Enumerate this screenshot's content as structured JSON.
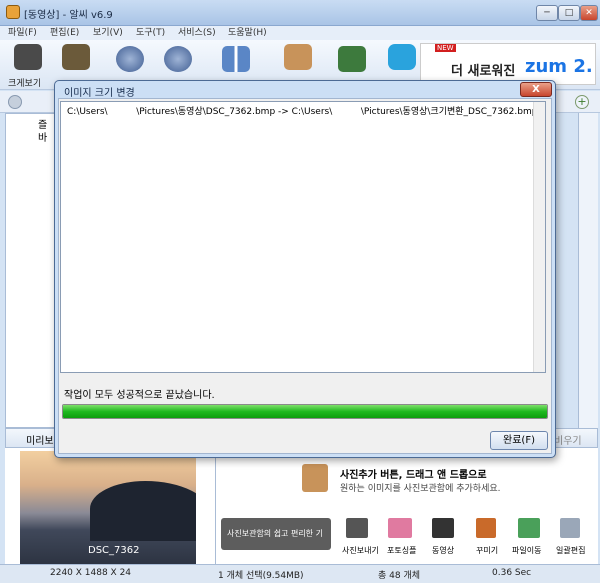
{
  "window": {
    "title": "[동영상] - 알씨 v6.9"
  },
  "menu": [
    "파일(F)",
    "편집(E)",
    "보기(V)",
    "도구(T)",
    "서비스(S)",
    "도움말(H)"
  ],
  "toolbar": {
    "first_label": "크게보기"
  },
  "ad": {
    "new_badge": "NEW",
    "text": "더 새로워진",
    "brand": "zum 2."
  },
  "tree": [
    "즐",
    "바"
  ],
  "preview": {
    "header": "미리보",
    "caption": "DSC_7362",
    "hidden_button": "비우기"
  },
  "storage": {
    "hint_title": "사진추가 버튼, 드래그 앤 드롭으로",
    "hint_sub": "원하는 이미지를 사진보관함에 추가하세요.",
    "banner": "사진보관함의 쉽고 편리한 기",
    "tools": [
      "사진보내기",
      "포토싱플",
      "동영상",
      "꾸미기",
      "파일이동",
      "일괄편집"
    ]
  },
  "status": {
    "dimensions": "2240 X 1488 X 24",
    "selected": "1 개체 선택(9.54MB)",
    "total": "총 48 개체",
    "time": "0.36 Sec"
  },
  "dialog": {
    "title": "이미지 크기 변경",
    "close": "X",
    "log": "C:\\Users\\          \\Pictures\\동영상\\DSC_7362.bmp -> C:\\Users\\          \\Pictures\\동영상\\크기변환_DSC_7362.bmp",
    "message": "작업이 모두 성공적으로 끝났습니다.",
    "progress": 1.0,
    "done_button": "완료(F)"
  },
  "colors": {
    "progress": "#1fb91f",
    "titlebar": "#a9c4e6",
    "close": "#c8452d"
  }
}
